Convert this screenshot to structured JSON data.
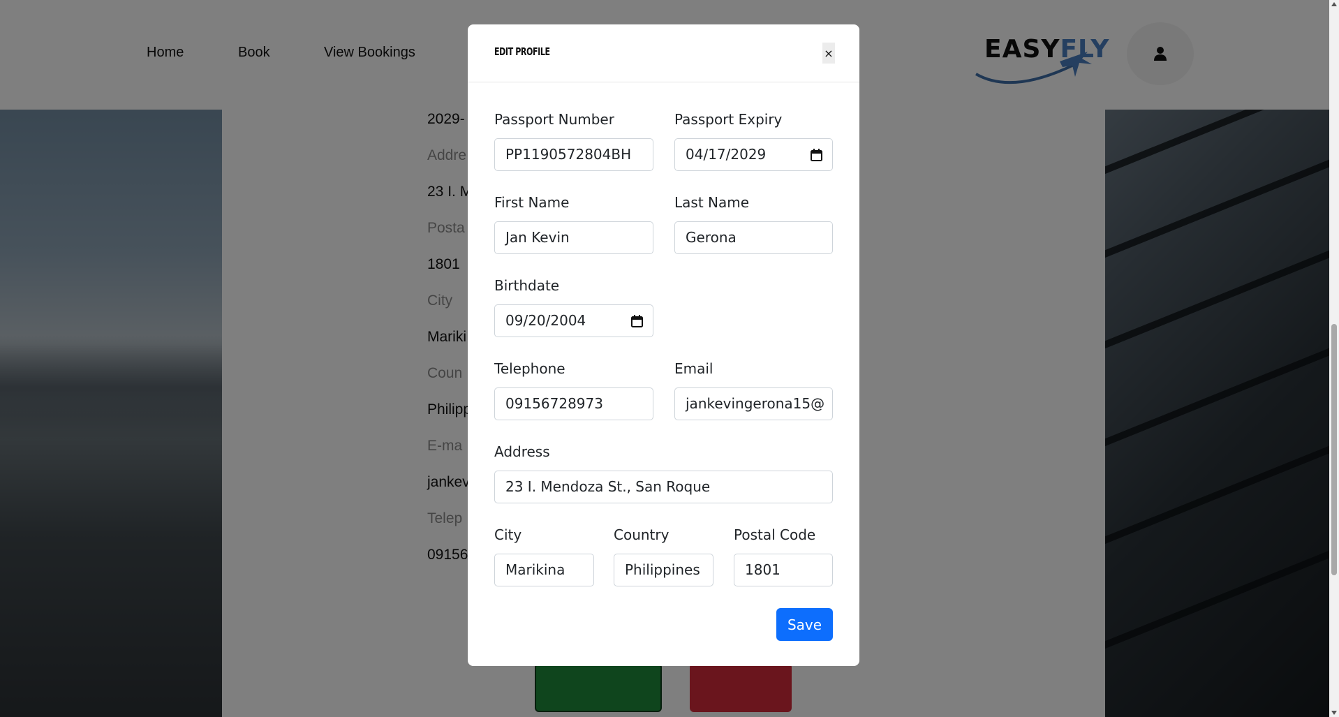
{
  "nav": {
    "links": [
      "Home",
      "Book",
      "View Bookings"
    ],
    "logo_text_1": "EASY",
    "logo_text_2": "FLY"
  },
  "background_profile": {
    "rows": [
      {
        "text": "2029-",
        "kind": "val"
      },
      {
        "text": "Addre",
        "kind": "lbl"
      },
      {
        "text": "23 I. M",
        "kind": "val"
      },
      {
        "text": "Posta",
        "kind": "lbl"
      },
      {
        "text": "1801",
        "kind": "val"
      },
      {
        "text": "City",
        "kind": "lbl"
      },
      {
        "text": "Mariki",
        "kind": "val"
      },
      {
        "text": "Coun",
        "kind": "lbl"
      },
      {
        "text": "Philipp",
        "kind": "val"
      },
      {
        "text": "E-ma",
        "kind": "lbl"
      },
      {
        "text": "jankev",
        "kind": "val"
      },
      {
        "text": "Telep",
        "kind": "lbl"
      },
      {
        "text": "09156",
        "kind": "val"
      }
    ]
  },
  "modal": {
    "title": "EDIT PROFILE",
    "close_label": "×",
    "fields": {
      "passport_number": {
        "label": "Passport Number",
        "value": "PP1190572804BH"
      },
      "passport_expiry": {
        "label": "Passport Expiry",
        "value": "04/17/2029"
      },
      "first_name": {
        "label": "First Name",
        "value": "Jan Kevin"
      },
      "last_name": {
        "label": "Last Name",
        "value": "Gerona"
      },
      "birthdate": {
        "label": "Birthdate",
        "value": "09/20/2004"
      },
      "telephone": {
        "label": "Telephone",
        "value": "09156728973"
      },
      "email": {
        "label": "Email",
        "value": "jankevingerona15@"
      },
      "address": {
        "label": "Address",
        "value": "23 I. Mendoza St., San Roque"
      },
      "city": {
        "label": "City",
        "value": "Marikina"
      },
      "country": {
        "label": "Country",
        "value": "Philippines"
      },
      "postal_code": {
        "label": "Postal Code",
        "value": "1801"
      }
    },
    "save_label": "Save"
  },
  "colors": {
    "primary": "#0d6efd",
    "overlay": "rgba(0,0,0,0.5)"
  }
}
